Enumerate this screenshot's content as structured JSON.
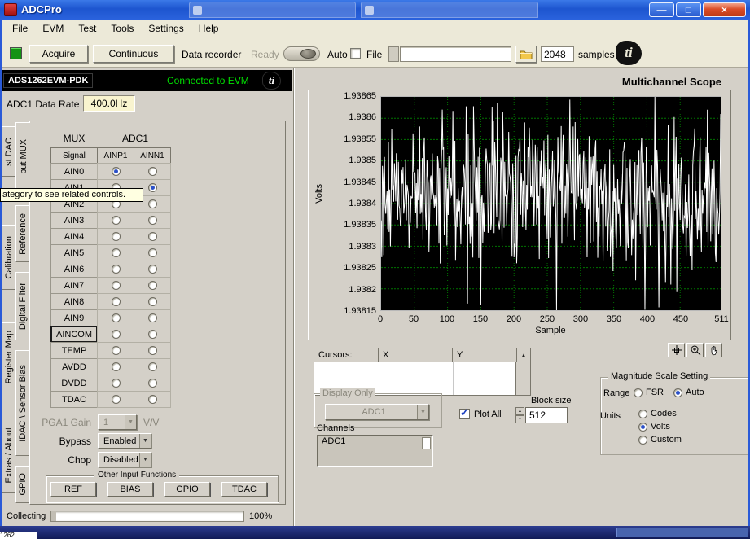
{
  "window": {
    "title": "ADCPro",
    "min": "—",
    "max": "□",
    "close": "×"
  },
  "menu": {
    "items": [
      "File",
      "EVM",
      "Test",
      "Tools",
      "Settings",
      "Help"
    ]
  },
  "toolbar": {
    "acquire_label": "Acquire",
    "continuous_label": "Continuous",
    "recorder_label": "Data recorder",
    "recorder_state": "Ready",
    "auto_label": "Auto",
    "file_label": "File",
    "file_path": "",
    "samples_value": "2048",
    "samples_label": "samples"
  },
  "device": {
    "name": "ADS1262EVM-PDK",
    "connection_status": "Connected to EVM",
    "data_rate_label": "ADC1 Data Rate",
    "data_rate_value": "400.0Hz"
  },
  "side_tabs": {
    "column1": [
      "st DAC",
      "Calibration",
      "Register Map",
      "Extras / About"
    ],
    "column2": [
      "put MUX",
      "Reference",
      "Digital Filter",
      "IDAC \\ Sensor Bias",
      "GPIO"
    ]
  },
  "tooltip": "ategory to see related controls.",
  "mux": {
    "group_label": "MUX",
    "adc_label": "ADC1",
    "signal_header": "Signal",
    "p_header": "AINP1",
    "n_header": "AINN1",
    "rows": [
      {
        "label": "AIN0",
        "p": true,
        "n": false
      },
      {
        "label": "AIN1",
        "p": false,
        "n": true
      },
      {
        "label": "AIN2",
        "p": false,
        "n": false
      },
      {
        "label": "AIN3",
        "p": false,
        "n": false
      },
      {
        "label": "AIN4",
        "p": false,
        "n": false
      },
      {
        "label": "AIN5",
        "p": false,
        "n": false
      },
      {
        "label": "AIN6",
        "p": false,
        "n": false
      },
      {
        "label": "AIN7",
        "p": false,
        "n": false
      },
      {
        "label": "AIN8",
        "p": false,
        "n": false
      },
      {
        "label": "AIN9",
        "p": false,
        "n": false
      },
      {
        "label": "AINCOM",
        "p": false,
        "n": false,
        "boxed": true
      },
      {
        "label": "TEMP",
        "p": false,
        "n": false
      },
      {
        "label": "AVDD",
        "p": false,
        "n": false
      },
      {
        "label": "DVDD",
        "p": false,
        "n": false
      },
      {
        "label": "TDAC",
        "p": false,
        "n": false
      }
    ]
  },
  "pga": {
    "gain_label": "PGA1 Gain",
    "gain_value": "1",
    "gain_unit": "V/V",
    "bypass_label": "Bypass",
    "bypass_value": "Enabled",
    "chop_label": "Chop",
    "chop_value": "Disabled"
  },
  "other_inputs": {
    "label": "Other Input Functions",
    "buttons": [
      "REF",
      "BIAS",
      "GPIO",
      "TDAC"
    ]
  },
  "status": {
    "label": "Collecting",
    "percent": "100%"
  },
  "scope": {
    "title": "Multichannel Scope",
    "cursors": {
      "col1": "Cursors:",
      "col2": "X",
      "col3": "Y"
    },
    "display_only": {
      "label": "Display Only",
      "value": "ADC1"
    },
    "plot_all_label": "Plot All",
    "block_size_label": "Block size",
    "block_size_value": "512",
    "channels_label": "Channels",
    "channels": [
      "ADC1"
    ],
    "magnitude": {
      "label": "Magnitude Scale Setting",
      "range_label": "Range",
      "range_options": [
        {
          "label": "FSR",
          "selected": false
        },
        {
          "label": "Auto",
          "selected": true
        }
      ],
      "units_label": "Units",
      "units_options": [
        {
          "label": "Codes",
          "selected": false
        },
        {
          "label": "Volts",
          "selected": true
        },
        {
          "label": "Custom",
          "selected": false
        }
      ]
    }
  },
  "chart_data": {
    "type": "line",
    "title": "Multichannel Scope",
    "xlabel": "Sample",
    "ylabel": "Volts",
    "xlim": [
      0,
      511
    ],
    "ylim": [
      1.93815,
      1.93865
    ],
    "grid": true,
    "legend_position": "none",
    "x_tick_values": [
      0,
      50,
      100,
      150,
      200,
      250,
      300,
      350,
      400,
      450,
      511
    ],
    "x_tick_labels": [
      "0",
      "50",
      "100",
      "150",
      "200",
      "250",
      "300",
      "350",
      "400",
      "450",
      "511"
    ],
    "y_tick_labels": [
      "1.93865",
      "1.9386",
      "1.93855",
      "1.9385",
      "1.93845",
      "1.9384",
      "1.93835",
      "1.9383",
      "1.93825",
      "1.9382",
      "1.93815"
    ],
    "series": [
      {
        "name": "ADC1",
        "kind": "noise",
        "samples": 512,
        "mean": 1.93842,
        "peak_to_peak": 0.0005
      }
    ],
    "plot_bg": "#000000",
    "grid_color": "#007400",
    "trace_color": "#ffffff"
  },
  "glyphs": {
    "dropdown_arrow": "▼",
    "spin_up": "▲",
    "spin_down": "▼",
    "scroll_up": "▲",
    "check": "✓",
    "ti_text": "ti"
  },
  "fragments": {
    "bottom_left": "1262"
  }
}
